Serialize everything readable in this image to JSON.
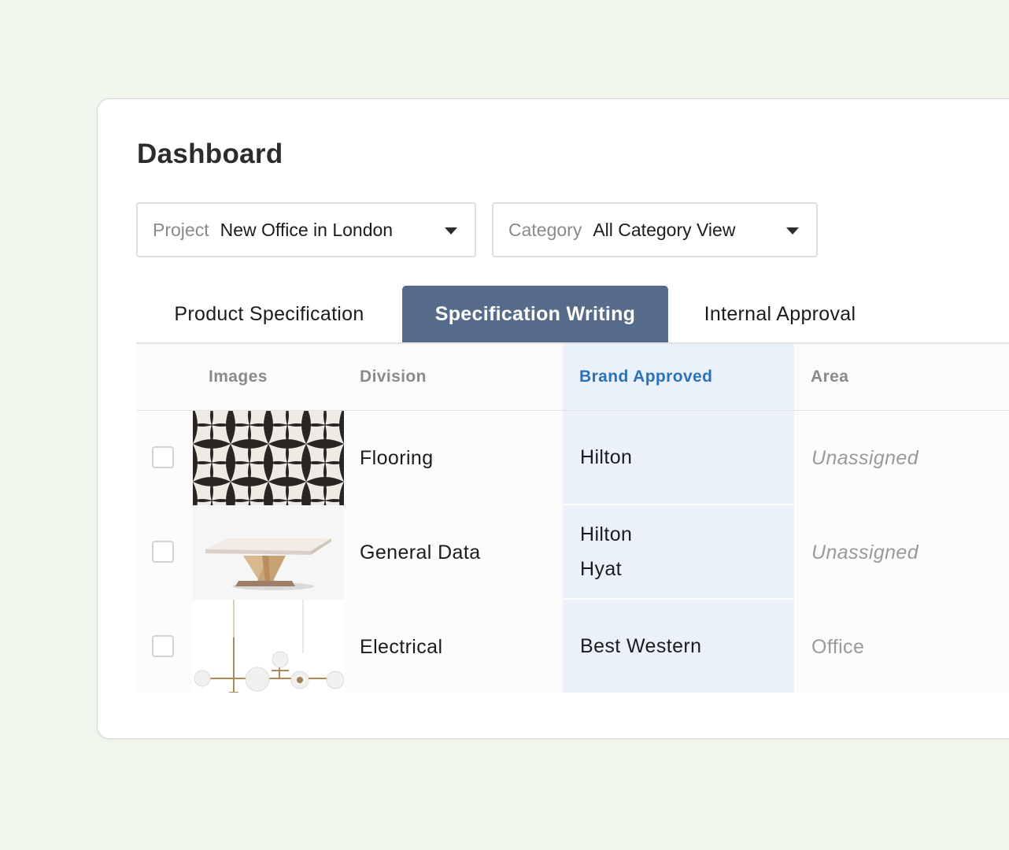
{
  "dashboard": {
    "title": "Dashboard"
  },
  "filters": {
    "project": {
      "label": "Project",
      "value": "New Office in London"
    },
    "category": {
      "label": "Category",
      "value": "All Category View"
    }
  },
  "tabs": [
    {
      "label": "Product Specification",
      "active": false
    },
    {
      "label": "Specification Writing",
      "active": true
    },
    {
      "label": "Internal Approval",
      "active": false
    }
  ],
  "table": {
    "columns": {
      "images": "Images",
      "division": "Division",
      "brand_approved": "Brand Approved",
      "area": "Area"
    },
    "rows": [
      {
        "image": "patterned-tile",
        "division": "Flooring",
        "brands": [
          "Hilton"
        ],
        "area": "Unassigned",
        "area_italic": true
      },
      {
        "image": "dining-table",
        "division": "General Data",
        "brands": [
          "Hilton",
          "Hyat"
        ],
        "area": "Unassigned",
        "area_italic": true
      },
      {
        "image": "pendant-light",
        "division": "Electrical",
        "brands": [
          "Best Western"
        ],
        "area": "Office",
        "area_italic": false
      }
    ]
  },
  "colors": {
    "page_background": "#f3f8ee",
    "active_tab": "#566b8a",
    "brand_column": "#eaf1fb",
    "brand_header_text": "#2b72b8"
  }
}
